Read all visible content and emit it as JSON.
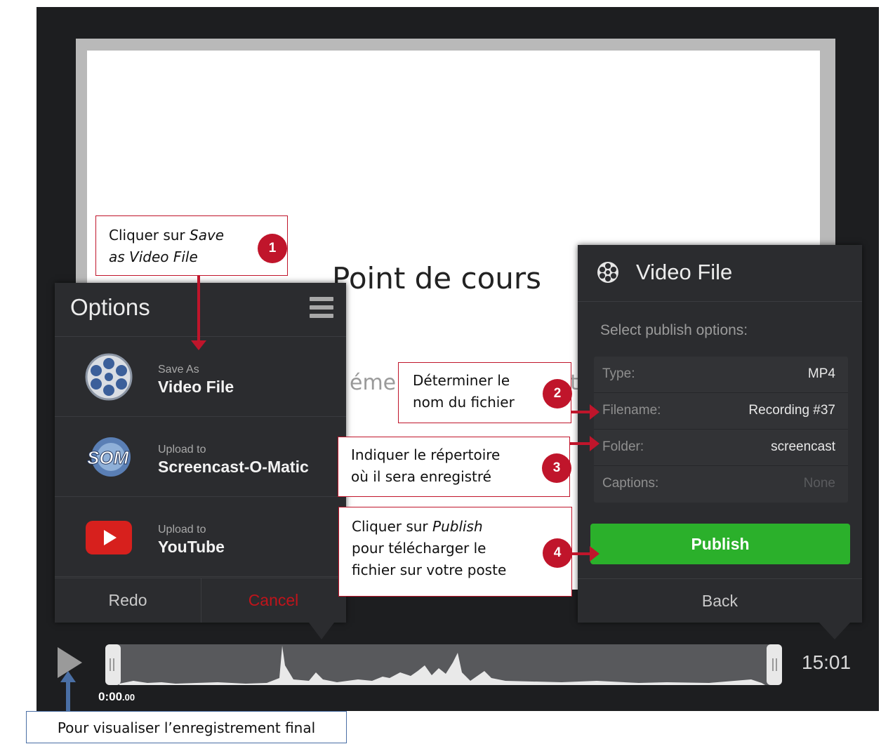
{
  "slide": {
    "title": "Point de cours",
    "subtitle_left": "éme",
    "subtitle_right": "t"
  },
  "options": {
    "title": "Options",
    "items": [
      {
        "small": "Save As",
        "big": "Video File",
        "icon": "film-reel-icon"
      },
      {
        "small": "Upload to",
        "big": "Screencast-O-Matic",
        "icon": "som-logo-icon"
      },
      {
        "small": "Upload to",
        "big": "YouTube",
        "icon": "youtube-icon"
      }
    ],
    "redo_label": "Redo",
    "cancel_label": "Cancel"
  },
  "video_file": {
    "title": "Video File",
    "select_label": "Select publish options:",
    "rows": [
      {
        "label": "Type:",
        "value": "MP4"
      },
      {
        "label": "Filename:",
        "value": "Recording #37"
      },
      {
        "label": "Folder:",
        "value": "screencast"
      },
      {
        "label": "Captions:",
        "value": "None"
      }
    ],
    "publish_label": "Publish",
    "back_label": "Back"
  },
  "timeline": {
    "start_time": "0:00",
    "start_time_fraction": ".00",
    "end_time": "15:01"
  },
  "annotations": {
    "c1_line1": "Cliquer sur ",
    "c1_italic1": "Save",
    "c1_italic2": "as Video File",
    "c2_line1": "Déterminer le",
    "c2_line2": "nom du fichier",
    "c3_line1": "Indiquer le répertoire",
    "c3_line2": "où il sera enregistré",
    "c4_line1": "Cliquer sur ",
    "c4_italic": "Publish",
    "c4_line2": "pour télécharger le",
    "c4_line3": "fichier sur votre poste",
    "badge1": "1",
    "badge2": "2",
    "badge3": "3",
    "badge4": "4",
    "play_hint": "Pour visualiser l’enregistrement final"
  },
  "colors": {
    "accent_red": "#c0152b",
    "publish_green": "#2bb02b",
    "hint_blue": "#4a6fa5",
    "cancel_red": "#c0141b"
  }
}
